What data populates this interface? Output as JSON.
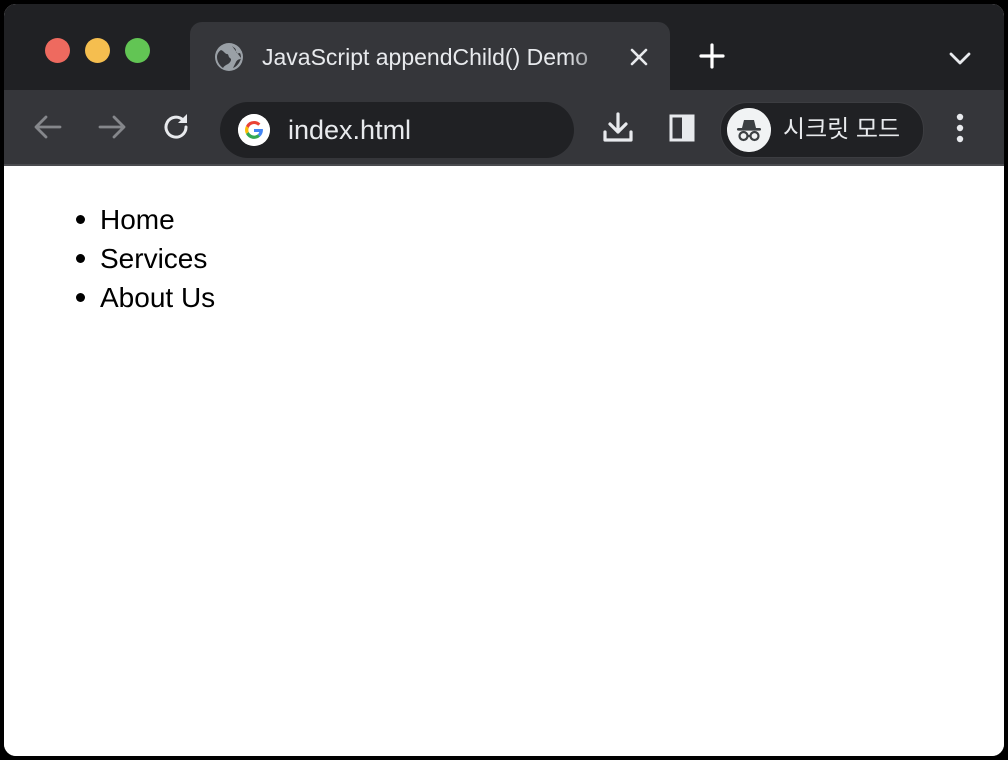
{
  "tab": {
    "title": "JavaScript appendChild() Demo",
    "icon": "globe-icon"
  },
  "toolbar": {
    "back_icon": "arrow-left-icon",
    "forward_icon": "arrow-right-icon",
    "reload_icon": "reload-icon",
    "download_icon": "download-icon",
    "side_panel_icon": "side-panel-icon",
    "menu_icon": "more-vert-icon"
  },
  "omnibox": {
    "url": "index.html",
    "icon": "google-icon"
  },
  "profile": {
    "label": "시크릿 모드",
    "icon": "incognito-icon"
  },
  "page": {
    "items": [
      "Home",
      "Services",
      "About Us"
    ]
  },
  "colors": {
    "tabstrip": "#202124",
    "toolbar": "#35363a",
    "close": "#ee6a5f",
    "minimize": "#f5be4f",
    "maximize": "#62c554"
  }
}
